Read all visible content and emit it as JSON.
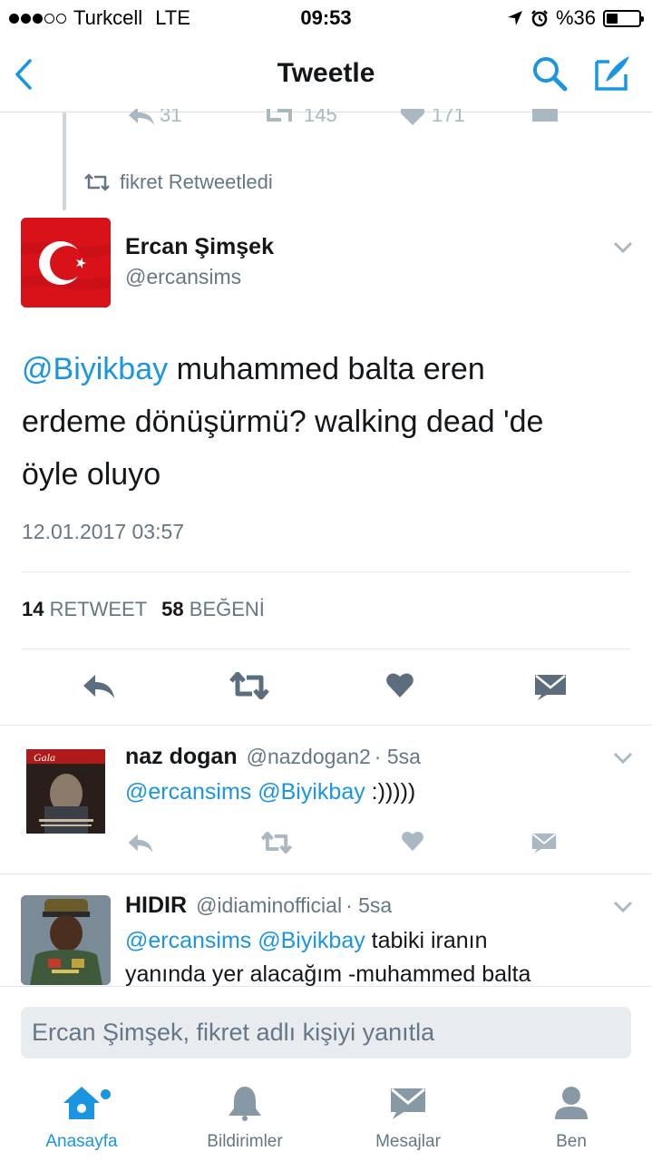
{
  "status_bar": {
    "carrier": "Turkcell",
    "network": "LTE",
    "time": "09:53",
    "battery": "%36",
    "battery_level": 0.36
  },
  "nav": {
    "title": "Tweetle",
    "back_icon": "chevron-left-icon",
    "search_icon": "search-icon",
    "compose_icon": "compose-tweet-icon"
  },
  "context": {
    "partial_counts": {
      "replies": "31",
      "retweets": "145",
      "likes": "171"
    },
    "retweet_note": "fikret Retweetledi"
  },
  "main_tweet": {
    "name": "Ercan Şimşek",
    "handle": "@ercansims",
    "mention": "@Biyikbay",
    "text_line1": " muhammed balta eren",
    "text_line2": "erdeme dönüşürmü? walking dead 'de",
    "text_line3": "öyle oluyo",
    "timestamp": "12.01.2017 03:57",
    "retweet_count": "14",
    "retweet_label": "RETWEET",
    "like_count": "58",
    "like_label": "BEĞENİ"
  },
  "replies": [
    {
      "name": "naz dogan",
      "handle": "@nazdogan2",
      "time": "· 5sa",
      "mention1": "@ercansims",
      "mention2": "@Biyikbay",
      "text": " :)))))"
    },
    {
      "name": "HIDIR",
      "handle": "@idiaminofficial",
      "time": "· 5sa",
      "mention1": "@ercansims",
      "mention2": "@Biyikbay",
      "text": " tabiki iranın",
      "text_line2": "yanında yer alacağım -muhammed balta"
    }
  ],
  "reply_composer": {
    "placeholder": "Ercan Şimşek, fikret adlı kişiyi yanıtla"
  },
  "tabs": [
    {
      "label": "Anasayfa",
      "icon": "home-icon",
      "active": true
    },
    {
      "label": "Bildirimler",
      "icon": "bell-icon",
      "active": false
    },
    {
      "label": "Mesajlar",
      "icon": "envelope-icon",
      "active": false
    },
    {
      "label": "Ben",
      "icon": "person-icon",
      "active": false
    }
  ],
  "colors": {
    "accent": "#1b95e0",
    "secondary_text": "#657786",
    "action_icons": "#5c6e7e"
  }
}
